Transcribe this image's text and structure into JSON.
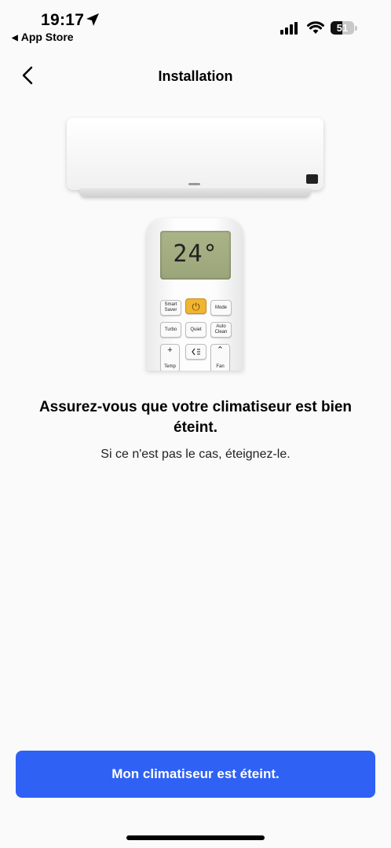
{
  "status_bar": {
    "time": "19:17",
    "back_app_label": "App Store",
    "battery_level": "51",
    "battery_fraction": 0.51
  },
  "nav": {
    "title": "Installation"
  },
  "illustration": {
    "display_temp": "24°",
    "remote_buttons": {
      "smart_saver": "Smart Saver",
      "mode": "Mode",
      "turbo": "Turbo",
      "quiet": "Quiet",
      "auto_clean": "Auto Clean",
      "temp_plus_symbol": "+",
      "temp_label": "Temp",
      "fan_label": "Fan"
    }
  },
  "content": {
    "heading": "Assurez-vous que votre climatiseur est bien éteint.",
    "subtext": "Si ce n'est pas le cas, éteignez-le."
  },
  "primary_button": {
    "label": "Mon climatiseur est éteint.",
    "color": "#2f61f4"
  }
}
